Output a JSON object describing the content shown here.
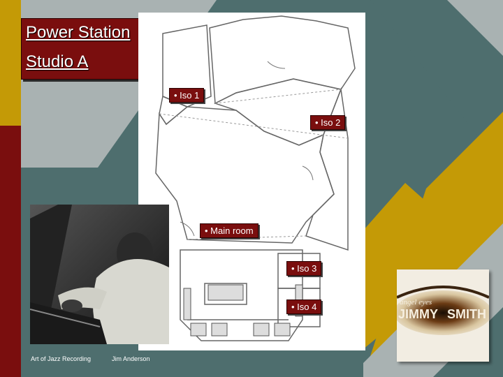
{
  "slide": {
    "title_line1": "Power Station",
    "title_line2": "Studio A",
    "footer_left": "Art of Jazz Recording",
    "footer_right": "Jim Anderson"
  },
  "floorplan": {
    "labels": {
      "iso1": "• Iso 1",
      "iso2": "• Iso 2",
      "main_room": "• Main room",
      "iso3": "• Iso 3",
      "iso4": "• Iso 4"
    }
  },
  "album": {
    "text_line1": "angel eyes",
    "text_jimmy": "JIMMY",
    "text_smith": "SMITH"
  },
  "colors": {
    "background": "#4e6e6e",
    "accent_gold": "#c49a06",
    "accent_red": "#7a0e0e",
    "light_gray": "#a9b2b2"
  }
}
